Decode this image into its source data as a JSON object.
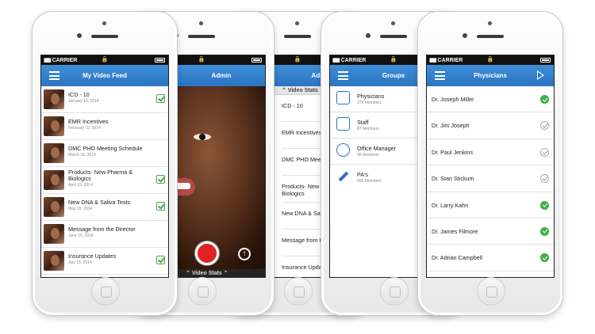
{
  "status_bar": {
    "carrier": "CARRIER",
    "signal_glyph": "▮▮▮",
    "lock_glyph": "🔒"
  },
  "video_feed": {
    "title": "My Video Feed",
    "items": [
      {
        "title": "ICD - 10",
        "date": "January 15, 2014",
        "checked": true
      },
      {
        "title": "EMR Incentives",
        "date": "February 15, 2014",
        "checked": false
      },
      {
        "title": "DMC PHO Meeting Schedule",
        "date": "March 15, 2014",
        "checked": false
      },
      {
        "title": "Products- New Pharma & Biologics",
        "date": "April 15, 2014",
        "checked": true
      },
      {
        "title": "New DNA & Saliva Tests",
        "date": "May 15, 2014",
        "checked": true
      },
      {
        "title": "Message from the Director",
        "date": "June 15, 2014",
        "checked": false
      },
      {
        "title": "Insurance Updates",
        "date": "July 15, 2014",
        "checked": true
      }
    ]
  },
  "admin_camera": {
    "title": "Admin",
    "stats_label": "Video Stats",
    "upload_glyph": "↑",
    "chevron_glyph": "⌃"
  },
  "admin_stats": {
    "title": "Admin",
    "stats_label": "Video Stats",
    "items": [
      "ICD - 10",
      "EMR Incentives",
      "DMC PHO Meeting Sche",
      "Products- New Pharma & Biologics",
      "New DNA & Saliva Tests",
      "Message from the Dir",
      "Insurance Updates"
    ]
  },
  "groups": {
    "title": "Groups",
    "items": [
      {
        "name": "Physicians",
        "members": "375 Members",
        "icon": "stethoscope-icon"
      },
      {
        "name": "Staff",
        "members": "87 Members",
        "icon": "staff-icon"
      },
      {
        "name": "Office Manager",
        "members": "38 Members",
        "icon": "person-icon"
      },
      {
        "name": "PA's",
        "members": "400 Members",
        "icon": "syringe-icon"
      }
    ]
  },
  "physicians": {
    "title": "Physicians",
    "items": [
      {
        "name": "Dr. Joseph Miller",
        "selected": true
      },
      {
        "name": "Dr. Jim Joseph",
        "selected": false
      },
      {
        "name": "Dr. Paul Jenkins",
        "selected": false
      },
      {
        "name": "Dr. Stan Stickum",
        "selected": false
      },
      {
        "name": "Dr. Larry Kahn",
        "selected": true
      },
      {
        "name": "Dr. James Filmore",
        "selected": true
      },
      {
        "name": "Dr. Adrian Campbell",
        "selected": true
      }
    ]
  },
  "colors": {
    "nav_blue": "#2b74c2",
    "check_green": "#46a846",
    "record_red": "#e02222"
  }
}
